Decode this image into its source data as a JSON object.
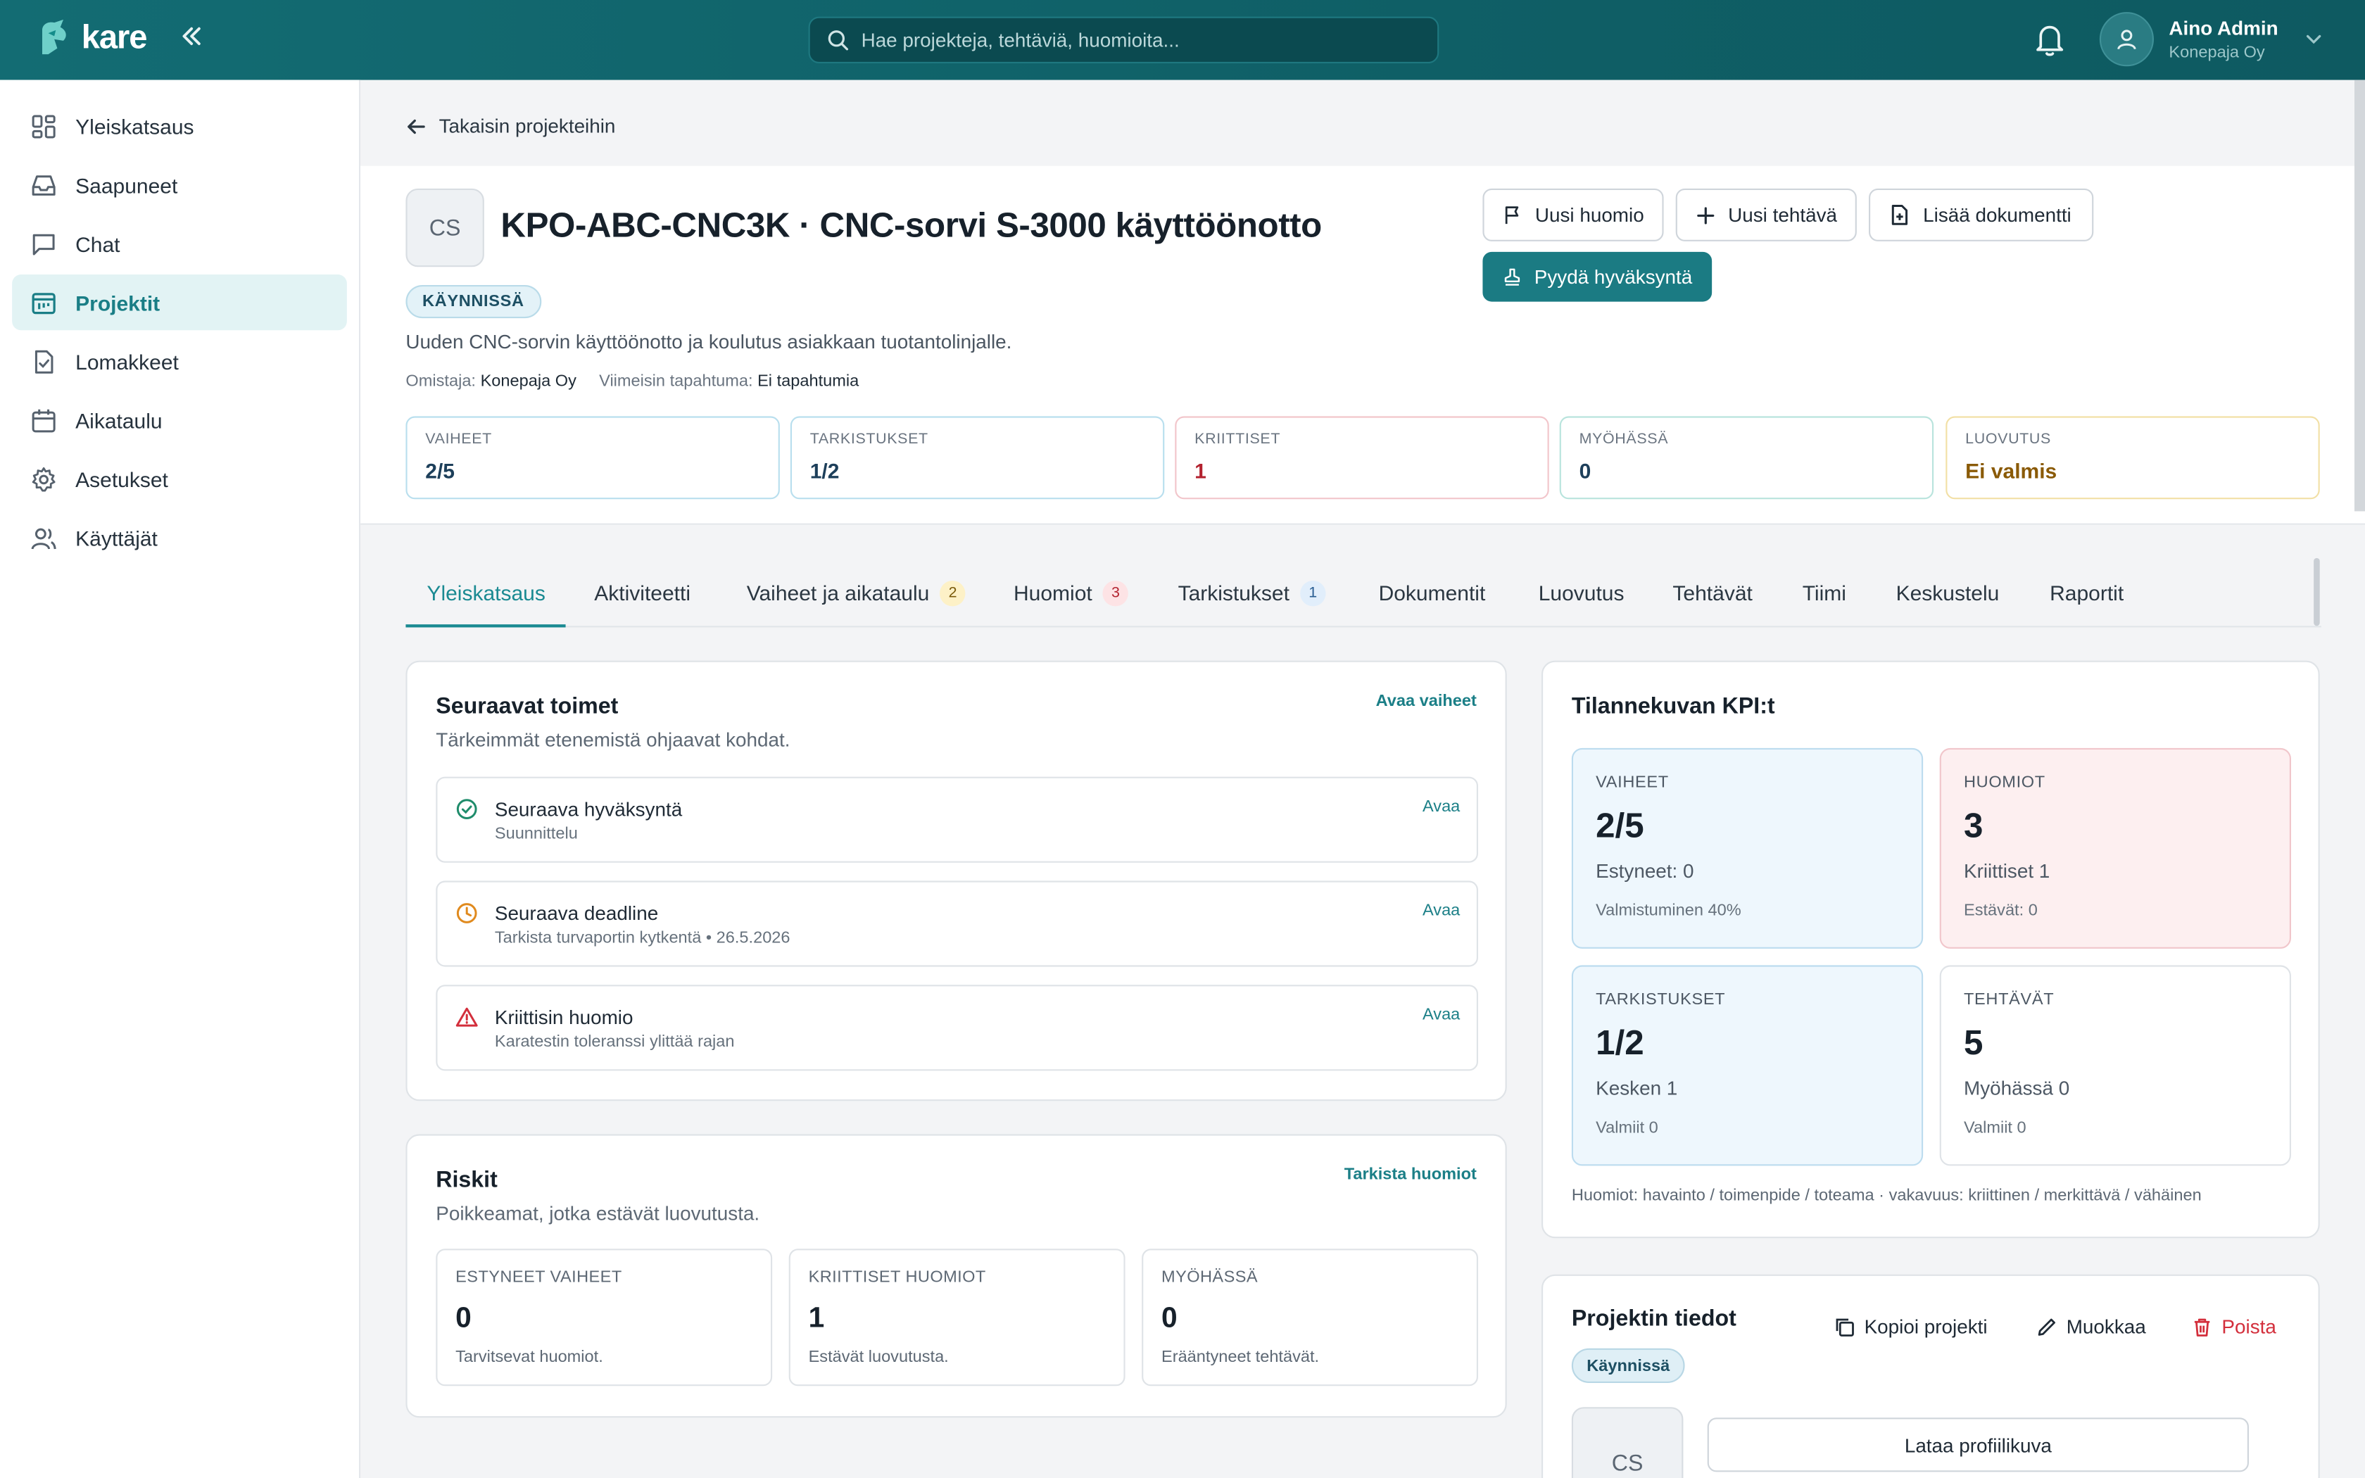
{
  "app": {
    "name": "kare"
  },
  "search": {
    "placeholder": "Hae projekteja, tehtäviä, huomioita..."
  },
  "user": {
    "name": "Aino Admin",
    "org": "Konepaja Oy"
  },
  "sidebar": {
    "items": [
      {
        "label": "Yleiskatsaus",
        "icon": "grid-icon",
        "active": false
      },
      {
        "label": "Saapuneet",
        "icon": "inbox-icon",
        "active": false
      },
      {
        "label": "Chat",
        "icon": "chat-icon",
        "active": false
      },
      {
        "label": "Projektit",
        "icon": "project-icon",
        "active": true
      },
      {
        "label": "Lomakkeet",
        "icon": "form-icon",
        "active": false
      },
      {
        "label": "Aikataulu",
        "icon": "calendar-icon",
        "active": false
      },
      {
        "label": "Asetukset",
        "icon": "gear-icon",
        "active": false
      },
      {
        "label": "Käyttäjät",
        "icon": "users-icon",
        "active": false
      }
    ]
  },
  "back": {
    "label": "Takaisin projekteihin"
  },
  "project": {
    "initials": "CS",
    "title": "KPO-ABC-CNC3K · CNC-sorvi S-3000 käyttöönotto",
    "status": "KÄYNNISSÄ",
    "description": "Uuden CNC-sorvin käyttöönotto ja koulutus asiakkaan tuotantolinjalle.",
    "owner_label": "Omistaja:",
    "owner": "Konepaja Oy",
    "last_event_label": "Viimeisin tapahtuma:",
    "last_event": "Ei tapahtumia"
  },
  "actions": {
    "new_note": "Uusi huomio",
    "new_task": "Uusi tehtävä",
    "add_document": "Lisää dokumentti",
    "request_approval": "Pyydä hyväksyntä"
  },
  "stats": [
    {
      "label": "VAIHEET",
      "value": "2/5",
      "color": "#1d3f5a",
      "border": "#b9dfee"
    },
    {
      "label": "TARKISTUKSET",
      "value": "1/2",
      "color": "#1d3f5a",
      "border": "#b9dfee"
    },
    {
      "label": "KRIITTISET",
      "value": "1",
      "color": "#b3222f",
      "border": "#f2c6cb"
    },
    {
      "label": "MYÖHÄSSÄ",
      "value": "0",
      "color": "#1d3f5a",
      "border": "#b9e4dd"
    },
    {
      "label": "LUOVUTUS",
      "value": "Ei valmis",
      "color": "#8a5a06",
      "border": "#f2e0a6"
    }
  ],
  "tabs": [
    {
      "label": "Yleiskatsaus",
      "badge": ""
    },
    {
      "label": "Aktiviteetti",
      "badge": ""
    },
    {
      "label": "Vaiheet ja aikataulu",
      "badge": "2"
    },
    {
      "label": "Huomiot",
      "badge": "3"
    },
    {
      "label": "Tarkistukset",
      "badge": "1"
    },
    {
      "label": "Dokumentit",
      "badge": ""
    },
    {
      "label": "Luovutus",
      "badge": ""
    },
    {
      "label": "Tehtävät",
      "badge": ""
    },
    {
      "label": "Tiimi",
      "badge": ""
    },
    {
      "label": "Keskustelu",
      "badge": ""
    },
    {
      "label": "Raportit",
      "badge": ""
    }
  ],
  "next_actions": {
    "title": "Seuraavat toimet",
    "subtitle": "Tärkeimmät etenemistä ohjaavat kohdat.",
    "link": "Avaa vaiheet",
    "items": [
      {
        "title": "Seuraava hyväksyntä",
        "sub": "Suunnittelu",
        "open": "Avaa",
        "icon": "check-circle-icon"
      },
      {
        "title": "Seuraava deadline",
        "sub": "Tarkista turvaportin kytkentä • 26.5.2026",
        "open": "Avaa",
        "icon": "clock-icon"
      },
      {
        "title": "Kriittisin huomio",
        "sub": "Karatestin toleranssi ylittää rajan",
        "open": "Avaa",
        "icon": "warning-icon"
      }
    ]
  },
  "risks": {
    "title": "Riskit",
    "subtitle": "Poikkeamat, jotka estävät luovutusta.",
    "link": "Tarkista huomiot",
    "items": [
      {
        "label": "ESTYNEET VAIHEET",
        "value": "0",
        "sub": "Tarvitsevat huomiot."
      },
      {
        "label": "KRIITTISET HUOMIOT",
        "value": "1",
        "sub": "Estävät luovutusta."
      },
      {
        "label": "MYÖHÄSSÄ",
        "value": "0",
        "sub": "Erääntyneet tehtävät."
      }
    ]
  },
  "kpis": {
    "title": "Tilannekuvan KPI:t",
    "items": [
      {
        "label": "VAIHEET",
        "value": "2/5",
        "sub1": "Estyneet: 0",
        "sub2": "Valmistuminen 40%",
        "bg": "#eef7fd",
        "border": "#bcdcef"
      },
      {
        "label": "HUOMIOT",
        "value": "3",
        "sub1": "Kriittiset 1",
        "sub2": "Estävät: 0",
        "bg": "#fdeff0",
        "border": "#f1c6cb"
      },
      {
        "label": "TARKISTUKSET",
        "value": "1/2",
        "sub1": "Kesken 1",
        "sub2": "Valmiit 0",
        "bg": "#eef7fd",
        "border": "#bcdcef"
      },
      {
        "label": "TEHTÄVÄT",
        "value": "5",
        "sub1": "Myöhässä 0",
        "sub2": "Valmiit 0",
        "bg": "#ffffff",
        "border": "#dfe3e7"
      }
    ],
    "note": "Huomiot: havainto / toimenpide / toteama · vakavuus: kriittinen / merkittävä / vähäinen"
  },
  "info": {
    "title": "Projektin tiedot",
    "copy": "Kopioi projekti",
    "edit": "Muokkaa",
    "delete": "Poista",
    "status": "Käynnissä",
    "initials": "CS",
    "upload": "Lataa profiilikuva"
  },
  "colors": {
    "brand": "#1b7b83",
    "danger": "#d32f3c"
  }
}
